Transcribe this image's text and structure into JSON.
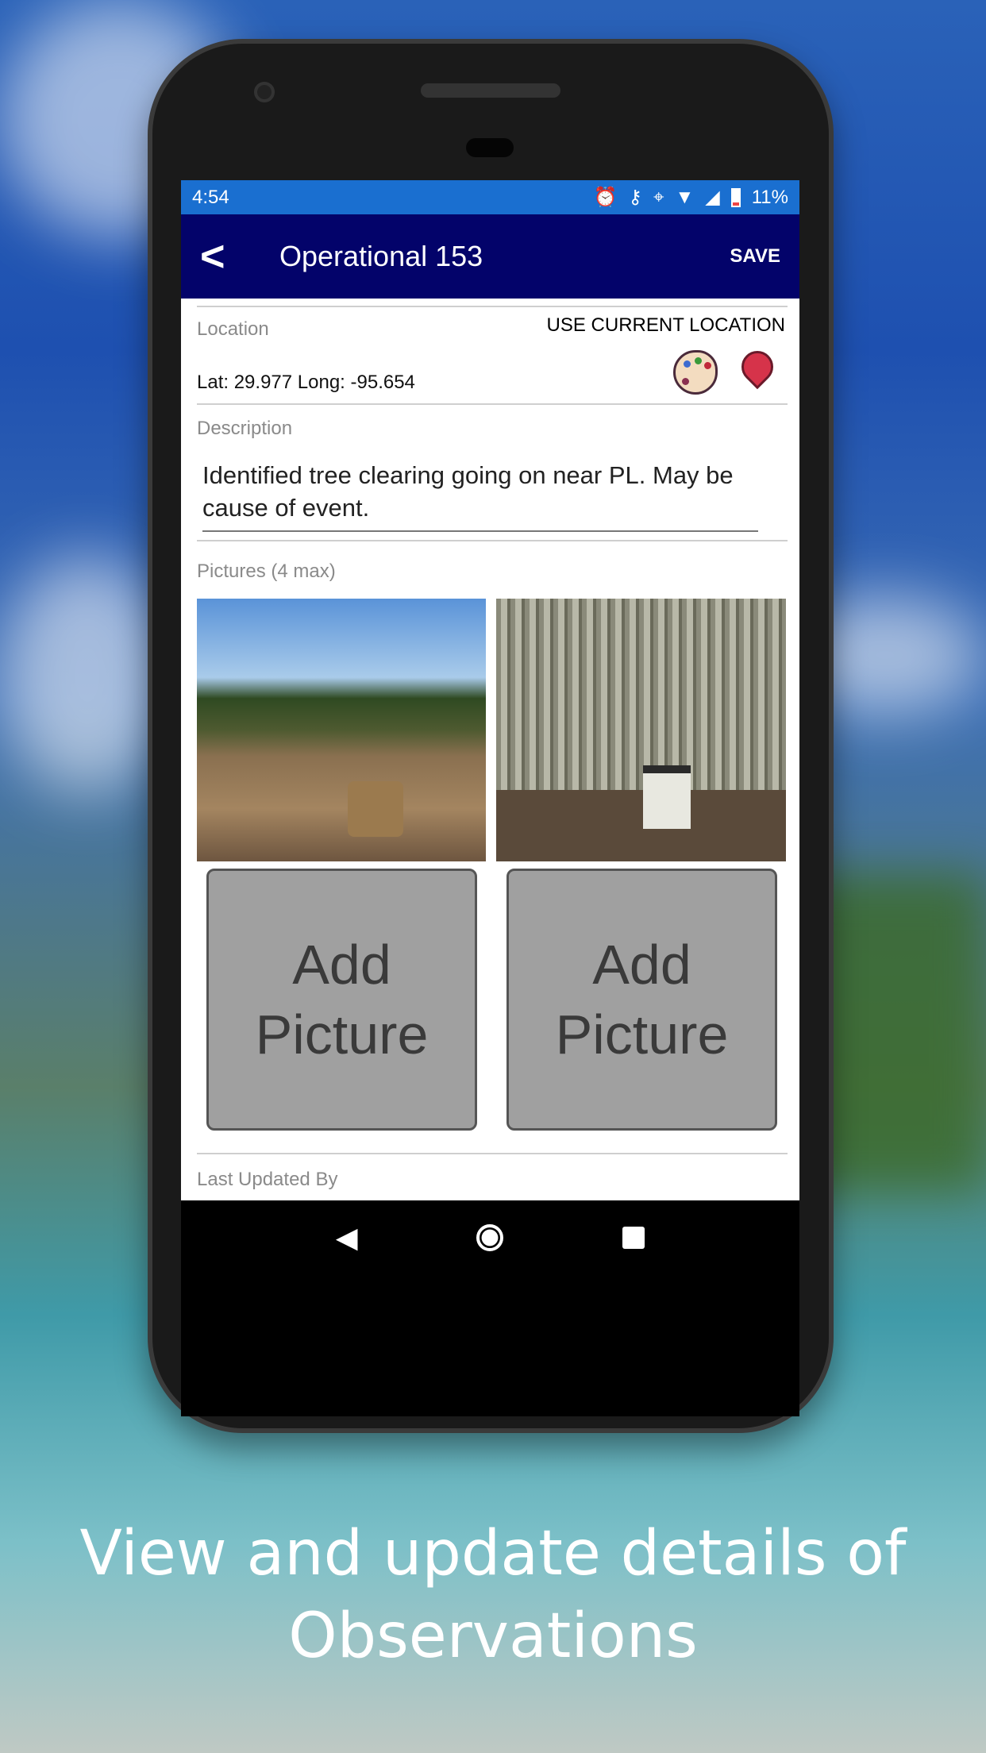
{
  "status_bar": {
    "time": "4:54",
    "battery": "11%",
    "icons": [
      "alarm-icon",
      "vpn-key-icon",
      "location-icon",
      "wifi-icon",
      "signal-icon",
      "battery-icon"
    ]
  },
  "app_bar": {
    "back_icon": "chevron-left-icon",
    "title": "Operational 153",
    "save_label": "SAVE"
  },
  "location": {
    "label": "Location",
    "use_current_label": "USE CURRENT LOCATION",
    "value": "Lat: 29.977 Long: -95.654",
    "icons": [
      "palette-icon",
      "map-pin-icon"
    ]
  },
  "description": {
    "label": "Description",
    "value": "Identified tree clearing going on near PL.  May be cause of event."
  },
  "pictures": {
    "label": "Pictures (4 max)",
    "add_labels": [
      "Add Picture",
      "Add Picture"
    ]
  },
  "last_updated": {
    "label": "Last Updated By"
  },
  "caption": {
    "line1": "View and update details of",
    "line2": "Observations"
  },
  "colors": {
    "status_bar": "#1a6fd0",
    "app_bar": "#03036a"
  }
}
